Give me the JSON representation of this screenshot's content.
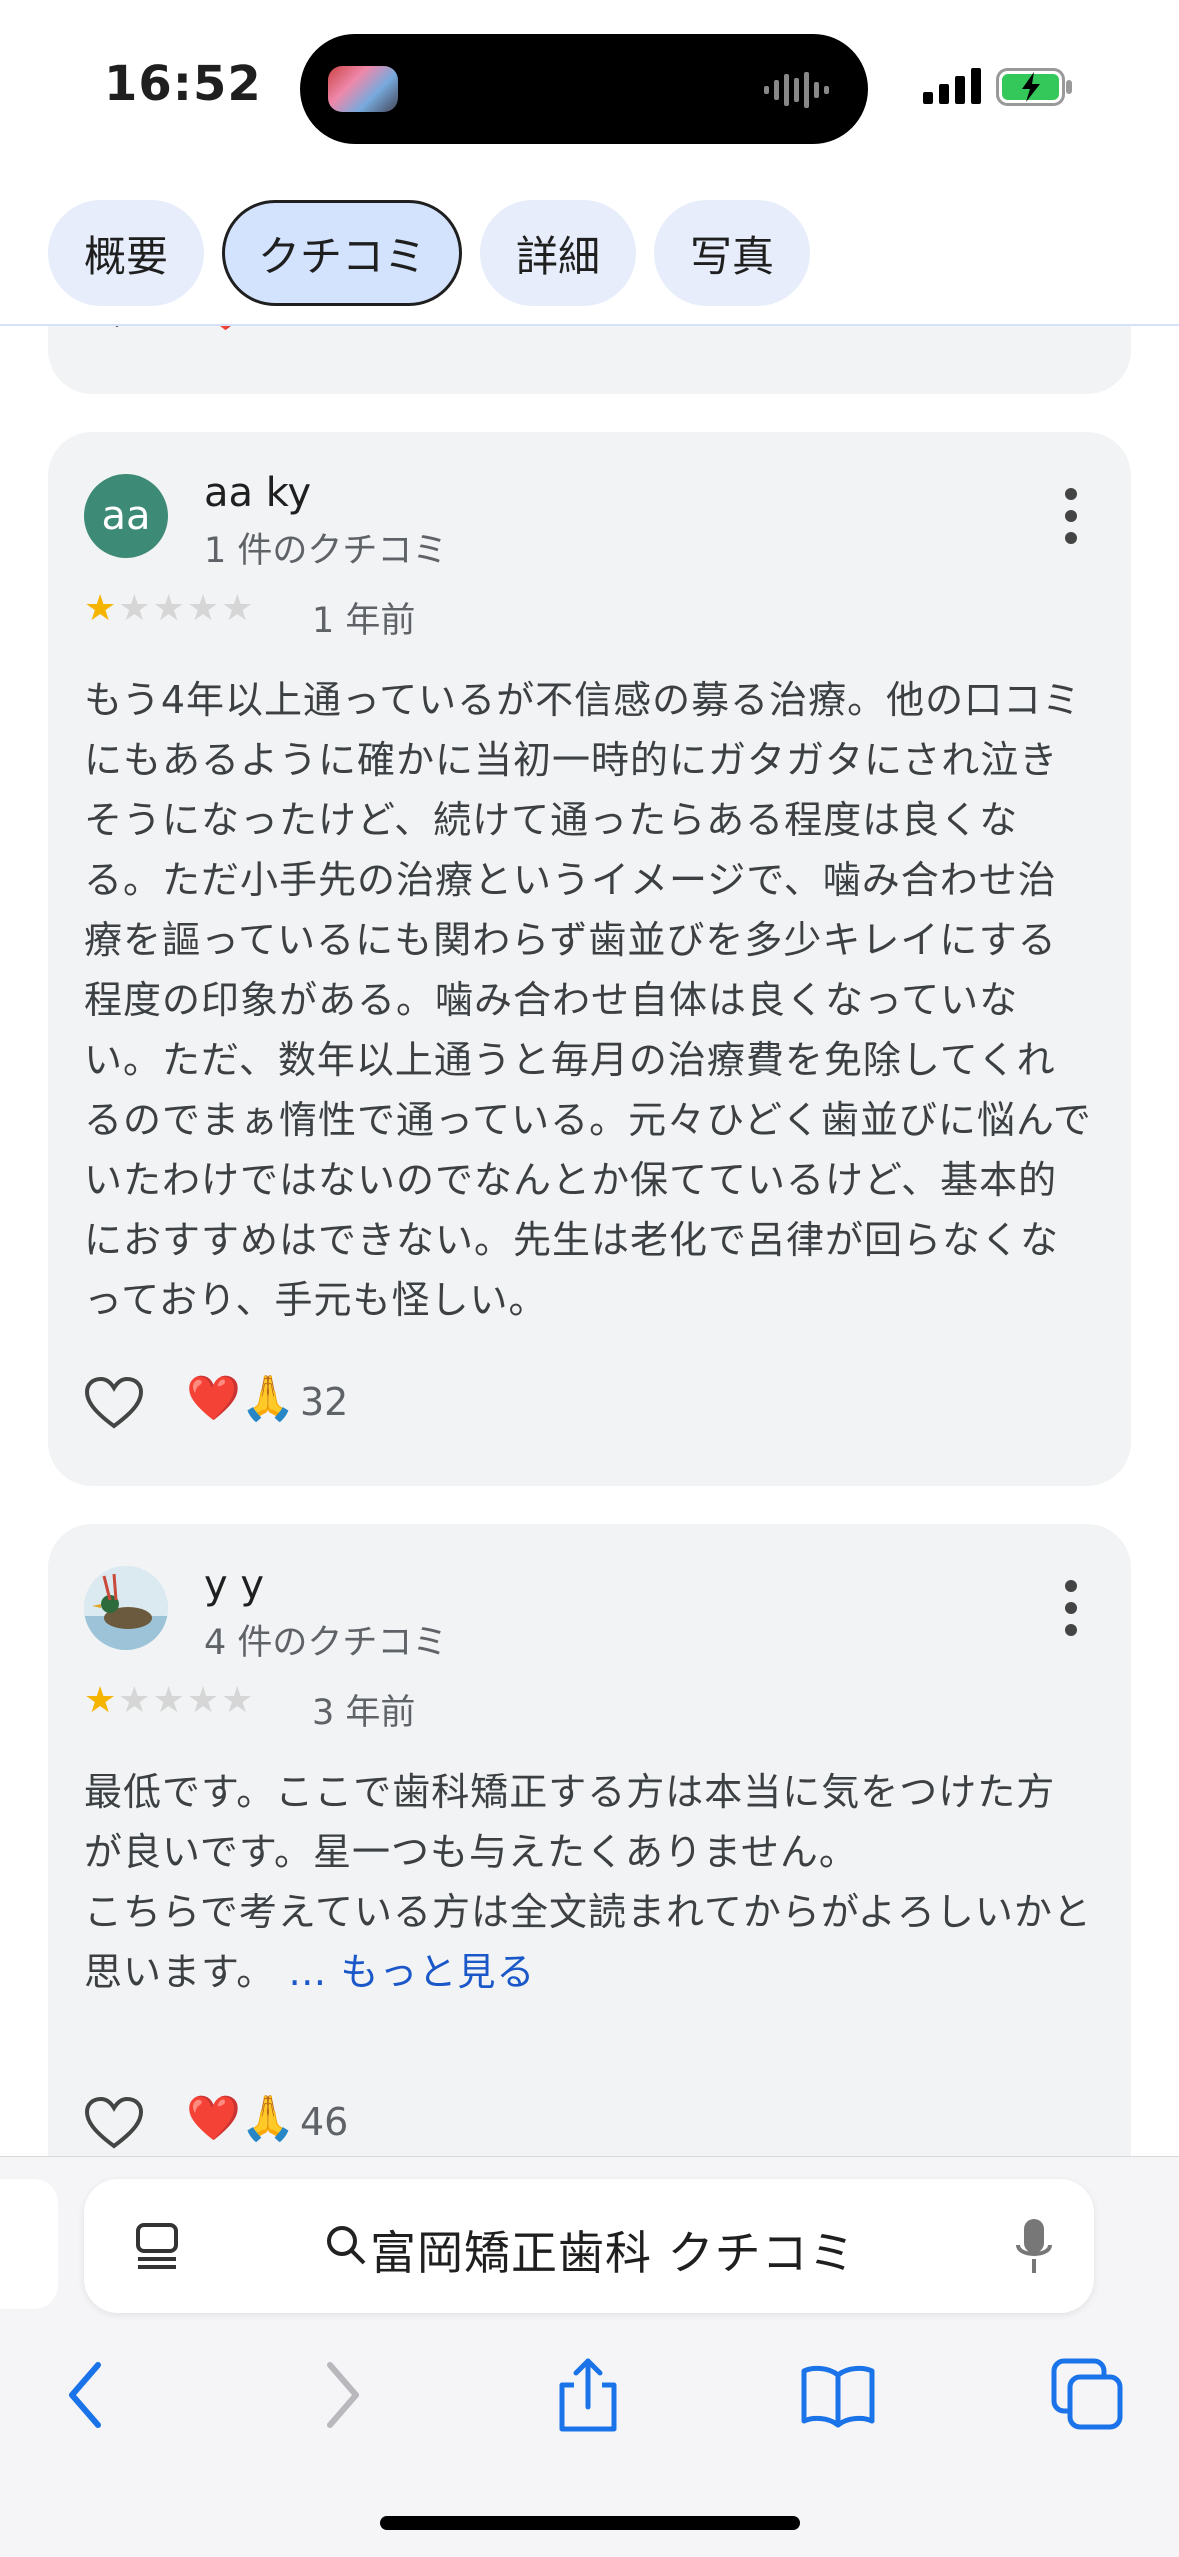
{
  "status_bar": {
    "time": "16:52"
  },
  "tabs": [
    {
      "label": "概要",
      "active": false
    },
    {
      "label": "クチコミ",
      "active": true
    },
    {
      "label": "詳細",
      "active": false
    },
    {
      "label": "写真",
      "active": false
    }
  ],
  "reviews": [
    {
      "avatar_text": "aa",
      "avatar_color": "#3d8b76",
      "name": "aa ky",
      "review_count": "1 件のクチコミ",
      "stars": "★★★★★",
      "rating": 1,
      "time_ago": "1 年前",
      "body": "もう4年以上通っているが不信感の募る治療。他の口コミにもあるように確かに当初一時的にガタガタにされ泣きそうになったけど、続けて通ったらある程度は良くなる。ただ小手先の治療というイメージで、噛み合わせ治療を謳っているにも関わらず歯並びを多少キレイにする程度の印象がある。噛み合わせ自体は良くなっていない。ただ、数年以上通うと毎月の治療費を免除してくれるのでまぁ惰性で通っている。元々ひどく歯並びに悩んでいたわけではないのでなんとか保てているけど、基本的におすすめはできない。先生は老化で呂律が回らなくなっており、手元も怪しい。",
      "reactions": "❤️🙏",
      "reaction_count": "32"
    },
    {
      "avatar_text": "",
      "name": "y y",
      "review_count": "4 件のクチコミ",
      "stars": "★★★★★",
      "rating": 1,
      "time_ago": "3 年前",
      "body_line1": "最低です。ここで歯科矯正する方は本当に気をつけた方が良いです。星一つも与えたくありません。",
      "body_line2": "こちらで考えている方は全文読まれてからがよろしいかと思います。",
      "more_link": "… もっと見る",
      "reactions": "❤️🙏",
      "reaction_count": "46"
    }
  ],
  "browser": {
    "url_text": "富岡矯正歯科 クチコミ",
    "accent_color": "#1a73e8"
  }
}
